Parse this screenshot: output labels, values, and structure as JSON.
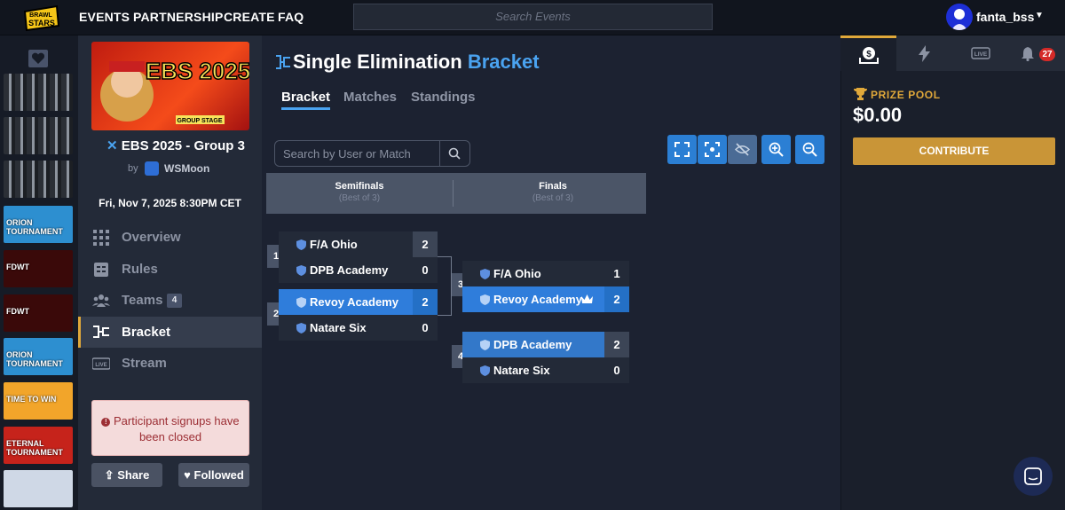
{
  "topbar": {
    "logo_text": "BRAWL STARS",
    "nav": [
      "EVENTS",
      "PARTNERSHIP",
      "CREATE",
      "FAQ"
    ],
    "search_placeholder": "Search Events",
    "username": "fanta_bss"
  },
  "left_rail": {
    "thumbs": [
      {
        "label": "",
        "color": "#5a5f66"
      },
      {
        "label": "",
        "color": "#5a5f66"
      },
      {
        "label": "",
        "color": "#5a5f66"
      },
      {
        "label": "ORION TOURNAMENT",
        "color": "#2d8fd0"
      },
      {
        "label": "FDWT",
        "color": "#3a0909"
      },
      {
        "label": "FDWT",
        "color": "#3a0909"
      },
      {
        "label": "ORION TOURNAMENT",
        "color": "#2d8fd0"
      },
      {
        "label": "TIME TO WIN",
        "color": "#f2a52a"
      },
      {
        "label": "ETERNAL TOURNAMENT",
        "color": "#c6231b"
      },
      {
        "label": "",
        "color": "#cfd8e6"
      }
    ]
  },
  "sidebar": {
    "banner_text": "EBS 2025",
    "banner_sub": "GROUP STAGE",
    "event_title": "EBS 2025 - Group 3",
    "by_label": "by",
    "host": "WSMoon",
    "date": "Fri, Nov 7, 2025 8:30PM CET",
    "nav": {
      "overview": "Overview",
      "rules": "Rules",
      "teams": "Teams",
      "bracket": "Bracket",
      "stream": "Stream"
    },
    "teams_count": "4",
    "signup_alert": "Participant signups have been closed",
    "share_label": "Share",
    "follow_label": "Followed"
  },
  "main": {
    "title_main": "Single Elimination",
    "title_accent": "Bracket",
    "tabs": {
      "bracket": "Bracket",
      "matches": "Matches",
      "standings": "Standings"
    },
    "search_placeholder": "Search by User or Match",
    "rounds": [
      {
        "name": "Semifinals",
        "bo": "(Best of 3)"
      },
      {
        "name": "Finals",
        "bo": "(Best of 3)"
      }
    ],
    "matches": {
      "m1": {
        "num": "1",
        "a": {
          "name": "F/A Ohio",
          "score": "2"
        },
        "b": {
          "name": "DPB Academy",
          "score": "0"
        }
      },
      "m2": {
        "num": "2",
        "a": {
          "name": "Revoy Academy",
          "score": "2"
        },
        "b": {
          "name": "Natare Six",
          "score": "0"
        }
      },
      "m3": {
        "num": "3",
        "a": {
          "name": "F/A Ohio",
          "score": "1"
        },
        "b": {
          "name": "Revoy Academy",
          "score": "2"
        }
      },
      "m4": {
        "num": "4",
        "a": {
          "name": "DPB Academy",
          "score": "2"
        },
        "b": {
          "name": "Natare Six",
          "score": "0"
        }
      }
    }
  },
  "right": {
    "tabs": [
      "prize-icon",
      "bolt-icon",
      "live-icon",
      "bell-icon"
    ],
    "live_label": "LIVE",
    "notif_count": "27",
    "prize_label": "PRIZE POOL",
    "prize_value": "$0.00",
    "contribute_label": "CONTRIBUTE"
  },
  "colors": {
    "accent_blue": "#4aa3f0",
    "gold": "#e0a83a",
    "win_blue": "#2f7ddb"
  }
}
